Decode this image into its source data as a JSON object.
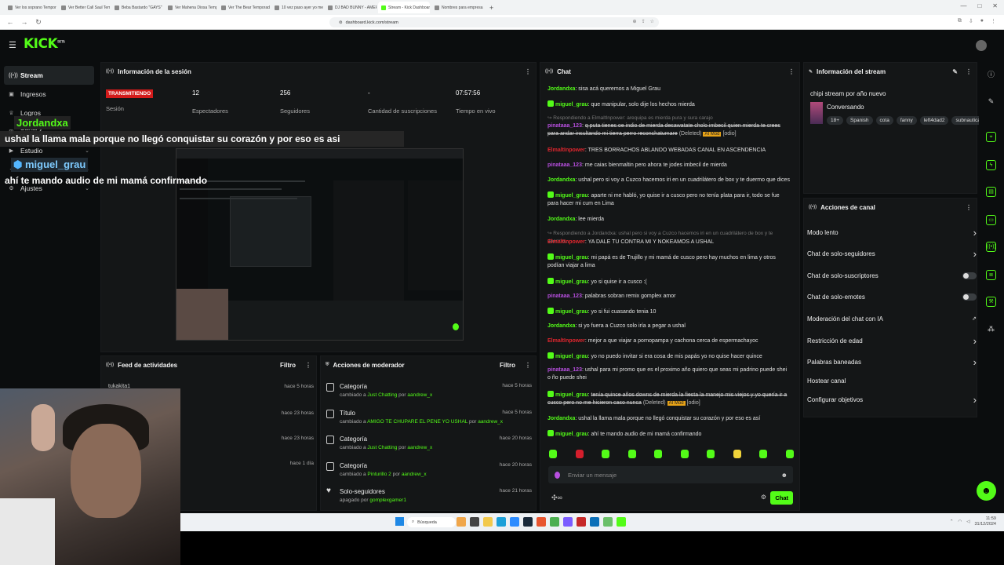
{
  "browser": {
    "tabs": [
      {
        "label": "Ver los soprano Temporada 6 Cap",
        "active": false
      },
      {
        "label": "Ver Better Call Saul Temporada 2 Ep",
        "active": false
      },
      {
        "label": "Beba Bastardo \"GAYS\"",
        "active": false
      },
      {
        "label": "Ver Mahena Diosa Temporada 2 Episodi",
        "active": false
      },
      {
        "label": "Ver The Bear Temporada 2 Episodio",
        "active": false
      },
      {
        "label": "10 vez paso ayer yo me viole dentro",
        "active": false
      },
      {
        "label": "DJ BAD BUNNY - AMERICONA",
        "active": false
      },
      {
        "label": "Stream - Kick Dashboard",
        "active": true
      },
      {
        "label": "Nombres para empresa internet",
        "active": false
      }
    ],
    "url": "dashboard.kick.com/stream"
  },
  "brand": {
    "logo": "KICK",
    "logo_sup": "BETA",
    "accent": "#53fc18"
  },
  "sidebar": {
    "items": [
      {
        "label": "Stream",
        "icon": "broadcast-icon",
        "active": true
      },
      {
        "label": "Ingresos",
        "icon": "wallet-icon",
        "active": false
      },
      {
        "label": "Logros",
        "icon": "trophy-icon",
        "active": false
      },
      {
        "label": "Canal y recompensas",
        "icon": "gift-icon",
        "active": false
      },
      {
        "label": "Estudio",
        "icon": "studio-icon",
        "active": false
      },
      {
        "label": "Crear",
        "icon": "plus-icon",
        "active": false
      },
      {
        "label": "Ajustes",
        "icon": "settings-icon",
        "active": false
      }
    ]
  },
  "session": {
    "title": "Información de la sesión",
    "status": "TRANSMITIENDO",
    "status_label": "Sesión",
    "stats": [
      {
        "value": "12",
        "label": "Espectadores"
      },
      {
        "value": "256",
        "label": "Seguidores"
      },
      {
        "value": "-",
        "label": "Cantidad de suscripciones"
      },
      {
        "value": "07:57:56",
        "label": "Tiempo en vivo"
      }
    ]
  },
  "overlay": {
    "user1": "Jordandxa",
    "msg1": "ushal la llama mala porque no llegó conquistar su corazón y por eso es asi",
    "user2": "miguel_grau",
    "msg2": "ahí te mando audio de mi mamá confirmando"
  },
  "feed": {
    "title": "Feed de actividades",
    "filter": "Filtro",
    "rows": [
      {
        "name": "tukakita1",
        "time": "hace 5 horas"
      },
      {
        "name": "",
        "time": "hace 23 horas"
      },
      {
        "name": "",
        "time": "hace 23 horas"
      },
      {
        "name": "",
        "time": "hace 1 día"
      }
    ]
  },
  "mod": {
    "title": "Acciones de moderador",
    "filter": "Filtro",
    "rows": [
      {
        "title": "Categoría",
        "pre": "cambiado a",
        "value": "Just Chatting",
        "by": "por",
        "user": "aandrew_x",
        "time": "hace 5 horas",
        "icon": "category-icon"
      },
      {
        "title": "Título",
        "pre": "cambiado a",
        "value": "AMIGO TE CHUPARE EL PENE YO USHAL",
        "by": "por",
        "user": "aandrew_x",
        "time": "hace 5 horas",
        "icon": "title-icon"
      },
      {
        "title": "Categoría",
        "pre": "cambiado a",
        "value": "Just Chatting",
        "by": "por",
        "user": "aandrew_x",
        "time": "hace 20 horas",
        "icon": "category-icon"
      },
      {
        "title": "Categoría",
        "pre": "cambiado a",
        "value": "Pinturillo 2",
        "by": "por",
        "user": "aandrew_x",
        "time": "hace 20 horas",
        "icon": "category-icon"
      },
      {
        "title": "Solo-seguidores",
        "pre": "apagado",
        "value": "",
        "by": "por",
        "user": "gomplexgamer1",
        "time": "hace 21 horas",
        "icon": "heart-icon"
      }
    ]
  },
  "chat": {
    "title": "Chat",
    "placeholder": "Enviar un mensaje",
    "send_label": "Chat",
    "messages": [
      {
        "user": "Jordandxa",
        "text": "sisa acá queremos a Miguel Grau",
        "color": "#53fc18",
        "badge": false,
        "reply": "",
        "deleted": false
      },
      {
        "user": "miguel_grau",
        "text": "que manipular, solo dije los hechos mierda",
        "color": "#53fc18",
        "badge": true,
        "reply": "",
        "deleted": false
      },
      {
        "user": "",
        "text": "",
        "color": "",
        "badge": false,
        "reply": "Respondiendo a ElmaltInpower: arequipa es mierda pura y sura carajo",
        "deleted": false
      },
      {
        "user": "pinataaa_123",
        "text": "q puta tienes oe indio de mierda desawatate cholo imbecil quien mierda te crees para andar insultando mi tierra perro reconchatumare",
        "color": "#b84fe0",
        "badge": false,
        "reply": "",
        "deleted": true
      },
      {
        "user": "ElmaltInpower",
        "text": "TRES BORRACHOS ABLANDO WEBADAS CANAL EN ASCENDENCIA",
        "color": "#e0262e",
        "badge": false,
        "reply": "",
        "deleted": false
      },
      {
        "user": "pinataaa_123",
        "text": "me caias bienmaltin pero ahora te jodes imbecil de mierda",
        "color": "#b84fe0",
        "badge": false,
        "reply": "",
        "deleted": false
      },
      {
        "user": "Jordandxa",
        "text": "ushal pero si voy a Cuzco hacemos iri en un cuadrilátero de box y te duermo que dices",
        "color": "#53fc18",
        "badge": false,
        "reply": "",
        "deleted": false
      },
      {
        "user": "miguel_grau",
        "text": "aparte ni me habló, yo quise ir a cusco pero no tenía plata para ir, todo se fue para hacer mi cum en Lima",
        "color": "#53fc18",
        "badge": true,
        "reply": "",
        "deleted": false
      },
      {
        "user": "Jordandxa",
        "text": "lee mierda",
        "color": "#53fc18",
        "badge": false,
        "reply": "",
        "deleted": false
      },
      {
        "user": "",
        "text": "",
        "color": "",
        "badge": false,
        "reply": "Respondiendo a Jordandxa: ushal pero si voy a Cuzco hacemos iri en un cuadrilátero de box y te duermo...",
        "deleted": false
      },
      {
        "user": "ElmaltInpower",
        "text": "YA DALE TU CONTRA MI Y NOKEAMOS A USHAL",
        "color": "#e0262e",
        "badge": false,
        "reply": "",
        "deleted": false
      },
      {
        "user": "miguel_grau",
        "text": "mi papá es de Trujillo y mi mamá de cusco pero hay muchos en lima y otros podían viajar a lima",
        "color": "#53fc18",
        "badge": true,
        "reply": "",
        "deleted": false
      },
      {
        "user": "miguel_grau",
        "text": "yo si quise ir a cusco :(",
        "color": "#53fc18",
        "badge": true,
        "reply": "",
        "deleted": false
      },
      {
        "user": "pinataaa_123",
        "text": "palabras sobran remix gomplex amor",
        "color": "#b84fe0",
        "badge": false,
        "reply": "",
        "deleted": false
      },
      {
        "user": "miguel_grau",
        "text": "yo si fui cuasando tenia 10",
        "color": "#53fc18",
        "badge": true,
        "reply": "",
        "deleted": false
      },
      {
        "user": "Jordandxa",
        "text": "si yo fuera a Cuzco solo iría a pegar a ushal",
        "color": "#53fc18",
        "badge": false,
        "reply": "",
        "deleted": false
      },
      {
        "user": "ElmaltInpower",
        "text": "mejor a que viajar a pornopampa y cachona cerca de espermachayoc",
        "color": "#e0262e",
        "badge": false,
        "reply": "",
        "deleted": false
      },
      {
        "user": "miguel_grau",
        "text": "yo no puedo invitar si era cosa de mis papás yo no quise hacer quince",
        "color": "#53fc18",
        "badge": true,
        "reply": "",
        "deleted": false
      },
      {
        "user": "pinataaa_123",
        "text": "ushal para mi promo que es el proximo año quiero que seas mi padrino puede shei o ño puede shei",
        "color": "#b84fe0",
        "badge": false,
        "reply": "",
        "deleted": false
      },
      {
        "user": "miguel_grau",
        "text": "tenía quince años downs de mierda la fiesta la manejo mis viejos y yo quería ir a cusco pero no me hicieron caso nunca",
        "color": "#53fc18",
        "badge": true,
        "reply": "",
        "deleted": true
      },
      {
        "user": "Jordandxa",
        "text": "ushal la llama mala porque no llegó conquistar su corazón y por eso es así",
        "color": "#53fc18",
        "badge": false,
        "reply": "",
        "deleted": false
      },
      {
        "user": "miguel_grau",
        "text": "ahí te mando audio de mi mamá confirmando",
        "color": "#53fc18",
        "badge": true,
        "reply": "",
        "deleted": false
      }
    ],
    "deleted_label": "(Deleted)",
    "mod_tag": "AI Mod",
    "mod_note": "[odio]"
  },
  "stream_info": {
    "title": "Información del stream",
    "stream_title": "chipi stream por año nuevo",
    "category": "Conversando",
    "tags": [
      "18+",
      "Spanish",
      "cota",
      "fanny",
      "left4dad2",
      "subnautica"
    ]
  },
  "channel_actions": {
    "title": "Acciones de canal",
    "items": [
      {
        "label": "Modo lento",
        "type": "chevron"
      },
      {
        "label": "Chat de solo-seguidores",
        "type": "chevron"
      },
      {
        "label": "Chat de solo-suscriptores",
        "type": "toggle"
      },
      {
        "label": "Chat de solo-emotes",
        "type": "toggle"
      },
      {
        "label": "Moderación del chat con IA",
        "type": "external"
      },
      {
        "label": "Restricción de edad",
        "type": "chevron"
      },
      {
        "label": "Palabras baneadas",
        "type": "chevron"
      },
      {
        "label": "Hostear canal",
        "type": "none"
      },
      {
        "label": "Configurar objetivos",
        "type": "chevron"
      }
    ]
  },
  "taskbar": {
    "search": "Búsqueda",
    "clock": "11:59",
    "date": "31/12/2024"
  }
}
